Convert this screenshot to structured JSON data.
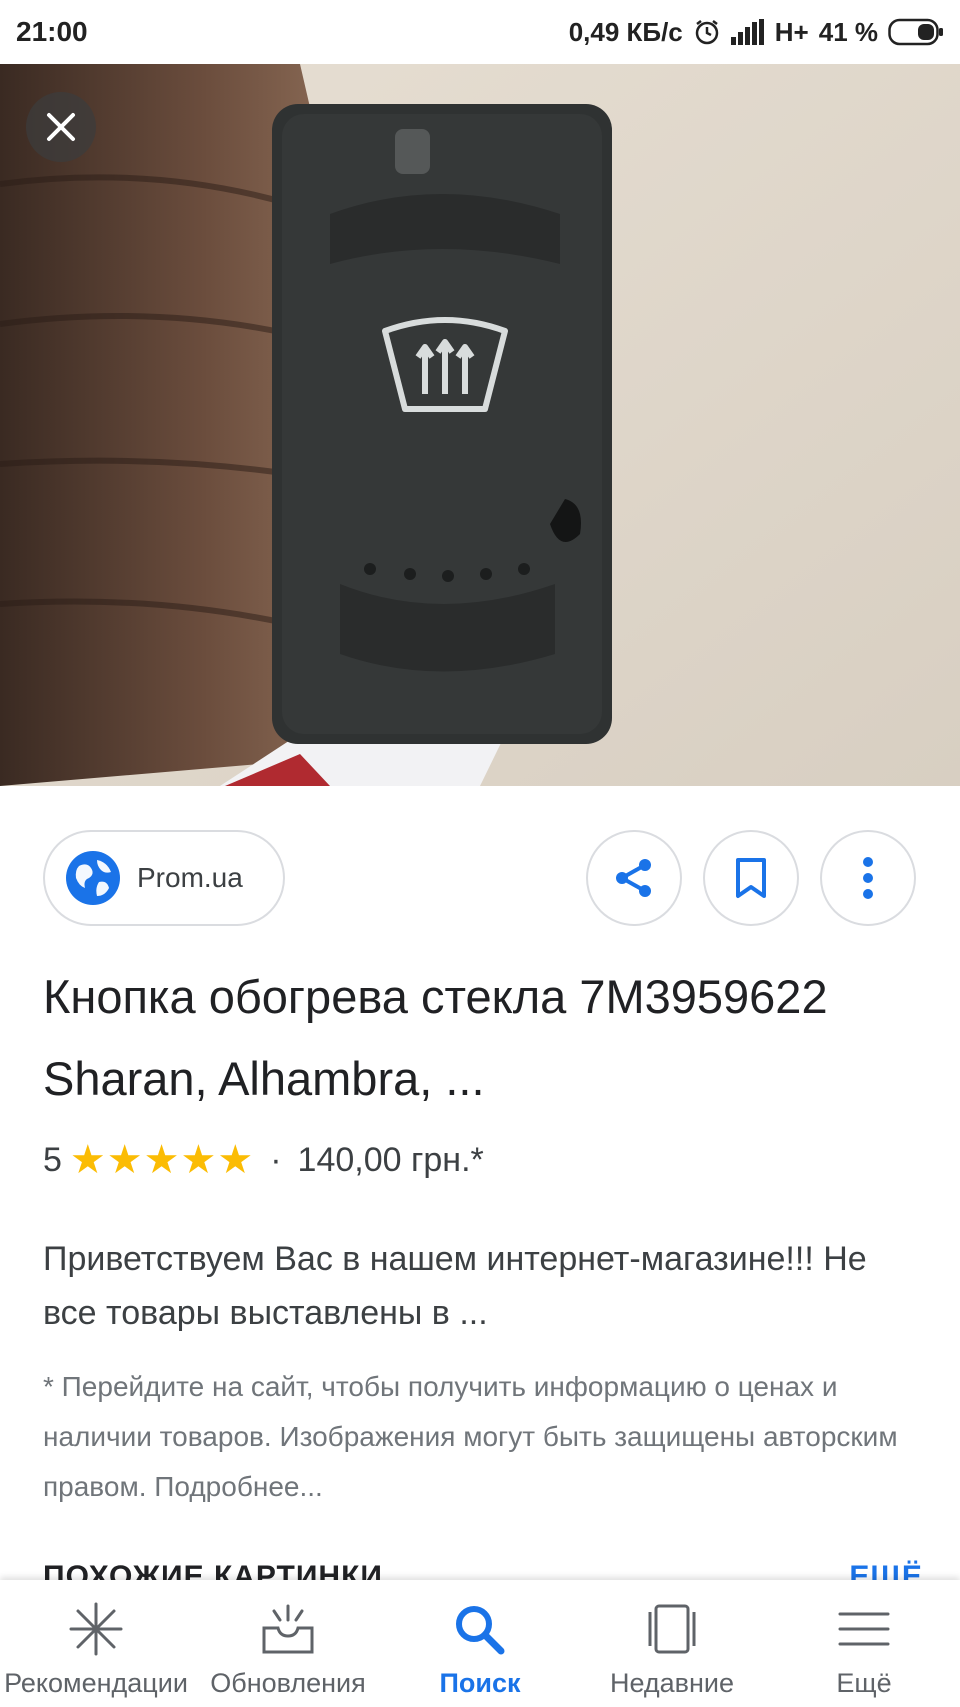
{
  "status_bar": {
    "time": "21:00",
    "speed": "0,49 КБ/с",
    "network": "H+",
    "battery": "41 %"
  },
  "image_viewer": {
    "close_icon": "close-icon"
  },
  "source": {
    "name": "Prom.ua",
    "icon": "globe-icon"
  },
  "actions": {
    "share_icon": "share-icon",
    "bookmark_icon": "bookmark-icon",
    "more_icon": "more-vert-icon"
  },
  "result": {
    "title": "Кнопка обогрева стекла 7M3959622 Sharan, Alhambra, ...",
    "rating": "5",
    "stars": 5,
    "separator": "·",
    "price": "140,00 грн.*",
    "description": "Приветствуем Вас в нашем интернет-магазине!!! Не все товары выставлены в ...",
    "note": "* Перейдите на сайт, чтобы получить информацию о ценах и наличии товаров. Изображения могут быть защищены авторским правом. Подробнее..."
  },
  "similar": {
    "heading": "ПОХОЖИЕ КАРТИНКИ",
    "more": "ЕЩЁ"
  },
  "bottom_nav": {
    "items": [
      {
        "label": "Рекомендации",
        "icon": "sparkle-icon"
      },
      {
        "label": "Обновления",
        "icon": "updates-tray-icon"
      },
      {
        "label": "Поиск",
        "icon": "search-icon"
      },
      {
        "label": "Недавние",
        "icon": "recent-tabs-icon"
      },
      {
        "label": "Ещё",
        "icon": "menu-icon"
      }
    ],
    "active_index": 2
  },
  "colors": {
    "accent": "#1a73e8",
    "star": "#fbbc04",
    "text": "#202124",
    "muted": "#70757a"
  }
}
